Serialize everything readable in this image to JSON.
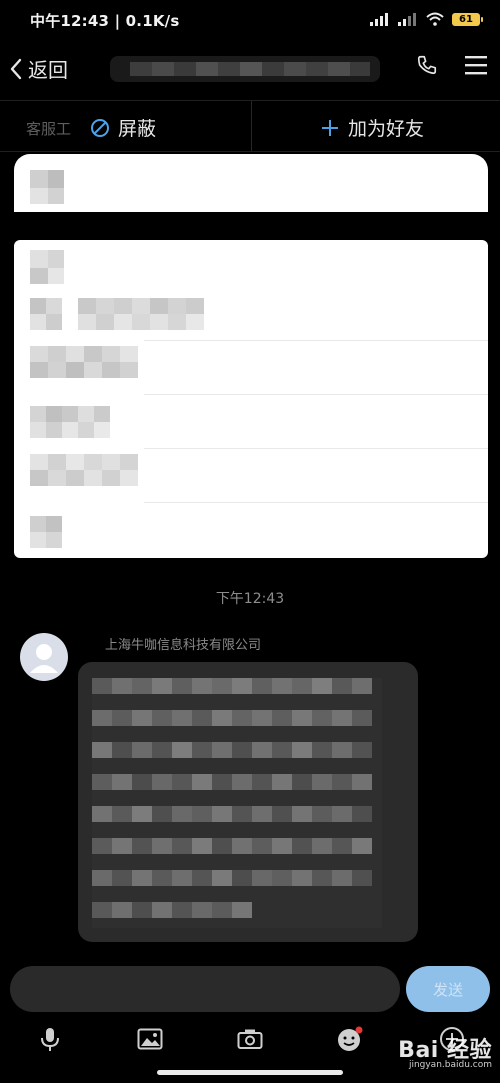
{
  "status_bar": {
    "time": "中午12:43 | 0.1K/s",
    "battery": "61"
  },
  "nav": {
    "back_label": "返回"
  },
  "actions": {
    "ghost": "客服工",
    "block_label": "屏蔽",
    "add_friend_label": "加为好友"
  },
  "chat": {
    "timestamp": "下午12:43",
    "sender": "上海牛咖信息科技有限公司"
  },
  "composer": {
    "placeholder": "",
    "send_label": "发送"
  },
  "watermark": {
    "main": "Bai 经验",
    "sub": "jingyan.baidu.com"
  },
  "colors": {
    "accent": "#4ea1e6",
    "send": "#8fc0ea",
    "background": "#000000",
    "bubble": "#2b2b2b"
  },
  "icons": [
    "signal-icon",
    "wifi-icon",
    "battery-icon",
    "chevron-left-icon",
    "phone-icon",
    "menu-icon",
    "block-icon",
    "plus-icon",
    "mic-icon",
    "image-icon",
    "camera-icon",
    "emoji-icon",
    "add-icon"
  ]
}
